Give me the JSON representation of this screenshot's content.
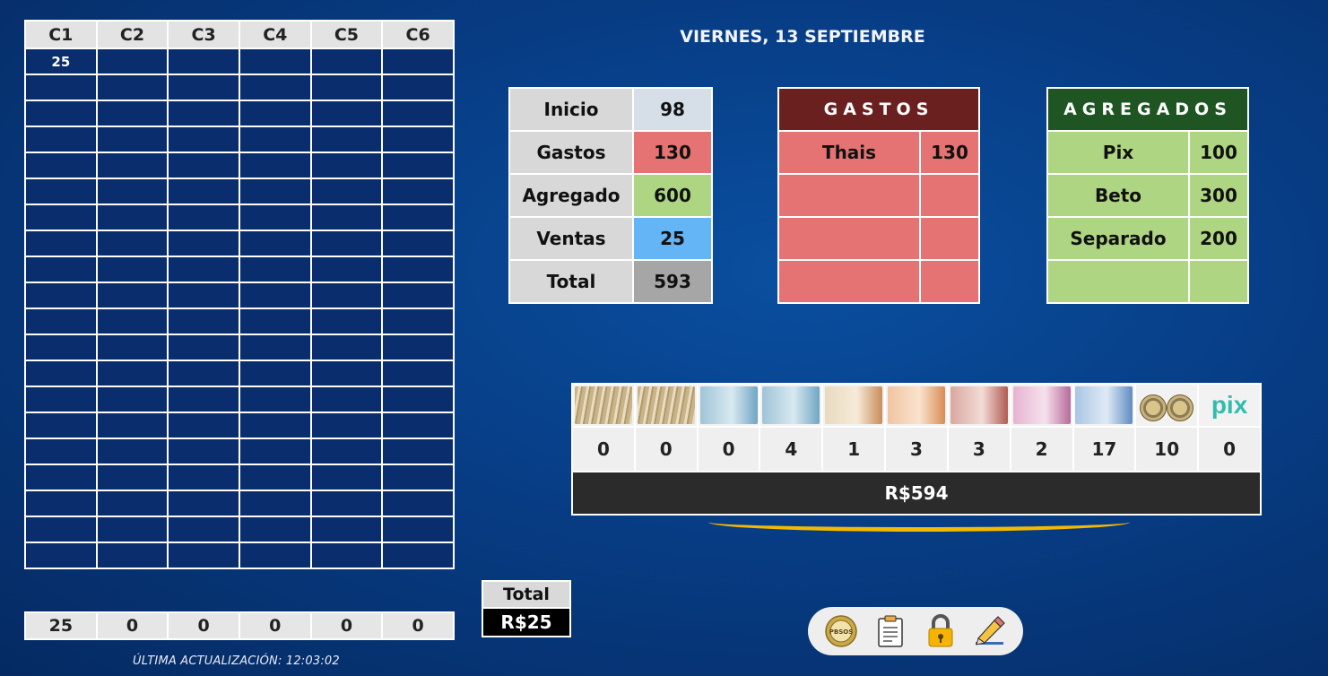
{
  "header": {
    "date": "VIERNES, 13 SEPTIEMBRE"
  },
  "grid": {
    "columns": [
      "C1",
      "C2",
      "C3",
      "C4",
      "C5",
      "C6"
    ],
    "rows": [
      [
        "25",
        "",
        "",
        "",
        "",
        ""
      ],
      [
        "",
        "",
        "",
        "",
        "",
        ""
      ],
      [
        "",
        "",
        "",
        "",
        "",
        ""
      ],
      [
        "",
        "",
        "",
        "",
        "",
        ""
      ],
      [
        "",
        "",
        "",
        "",
        "",
        ""
      ],
      [
        "",
        "",
        "",
        "",
        "",
        ""
      ],
      [
        "",
        "",
        "",
        "",
        "",
        ""
      ],
      [
        "",
        "",
        "",
        "",
        "",
        ""
      ],
      [
        "",
        "",
        "",
        "",
        "",
        ""
      ],
      [
        "",
        "",
        "",
        "",
        "",
        ""
      ],
      [
        "",
        "",
        "",
        "",
        "",
        ""
      ],
      [
        "",
        "",
        "",
        "",
        "",
        ""
      ],
      [
        "",
        "",
        "",
        "",
        "",
        ""
      ],
      [
        "",
        "",
        "",
        "",
        "",
        ""
      ],
      [
        "",
        "",
        "",
        "",
        "",
        ""
      ],
      [
        "",
        "",
        "",
        "",
        "",
        ""
      ],
      [
        "",
        "",
        "",
        "",
        "",
        ""
      ],
      [
        "",
        "",
        "",
        "",
        "",
        ""
      ],
      [
        "",
        "",
        "",
        "",
        "",
        ""
      ],
      [
        "",
        "",
        "",
        "",
        "",
        ""
      ]
    ],
    "totals": [
      "25",
      "0",
      "0",
      "0",
      "0",
      "0"
    ]
  },
  "last_update": "ÚLTIMA ACTUALIZACIÓN: 12:03:02",
  "summary": [
    {
      "label": "Inicio",
      "value": "98",
      "color": "#d6dfe8"
    },
    {
      "label": "Gastos",
      "value": "130",
      "color": "#e57373"
    },
    {
      "label": "Agregado",
      "value": "600",
      "color": "#aed581"
    },
    {
      "label": "Ventas",
      "value": "25",
      "color": "#64b5f6"
    },
    {
      "label": "Total",
      "value": "593",
      "color": "#a6a6a6"
    }
  ],
  "gastos": {
    "title": "GASTOS",
    "rows": [
      {
        "name": "Thais",
        "amount": "130"
      },
      {
        "name": "",
        "amount": ""
      },
      {
        "name": "",
        "amount": ""
      },
      {
        "name": "",
        "amount": ""
      }
    ]
  },
  "agregados": {
    "title": "AGREGADOS",
    "rows": [
      {
        "name": "Pix",
        "amount": "100"
      },
      {
        "name": "Beto",
        "amount": "300"
      },
      {
        "name": "Separado",
        "amount": "200"
      },
      {
        "name": "",
        "amount": ""
      }
    ]
  },
  "money": {
    "denominations": [
      {
        "icon": "banknote-stack-icon",
        "count": "0"
      },
      {
        "icon": "banknote-stack-icon",
        "count": "0"
      },
      {
        "icon": "banknote-200-icon",
        "count": "0"
      },
      {
        "icon": "banknote-100-icon",
        "count": "4"
      },
      {
        "icon": "banknote-50-icon",
        "count": "1"
      },
      {
        "icon": "banknote-20-icon",
        "count": "3"
      },
      {
        "icon": "banknote-10-icon",
        "count": "3"
      },
      {
        "icon": "banknote-5-icon",
        "count": "2"
      },
      {
        "icon": "banknote-2-icon",
        "count": "17"
      },
      {
        "icon": "coins-icon",
        "count": "10"
      },
      {
        "icon": "pix-icon",
        "count": "0"
      }
    ],
    "pix_logo": "pix",
    "total": "R$594"
  },
  "total_box": {
    "label": "Total",
    "value": "R$25"
  },
  "toolbar": {
    "icons": [
      "pbsos-seal-icon",
      "clipboard-icon",
      "lock-icon",
      "edit-pencil-icon"
    ],
    "seal_text": "PBSOS"
  }
}
